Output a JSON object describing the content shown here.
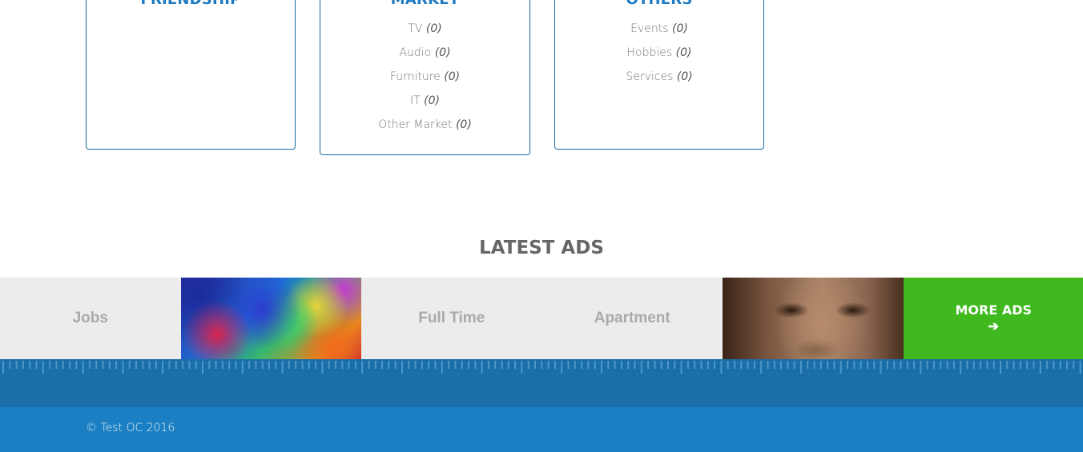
{
  "categories": [
    {
      "title": "FRIENDSHIP",
      "items": []
    },
    {
      "title": "MARKET",
      "items": [
        {
          "label": "TV",
          "count": "(0)"
        },
        {
          "label": "Audio",
          "count": "(0)"
        },
        {
          "label": "Furniture",
          "count": "(0)"
        },
        {
          "label": "IT",
          "count": "(0)"
        },
        {
          "label": "Other Market",
          "count": "(0)"
        }
      ]
    },
    {
      "title": "OTHERS",
      "items": [
        {
          "label": "Events",
          "count": "(0)"
        },
        {
          "label": "Hobbies",
          "count": "(0)"
        },
        {
          "label": "Services",
          "count": "(0)"
        }
      ]
    }
  ],
  "latest_ads": {
    "title": "LATEST ADS",
    "tiles": [
      {
        "label": "Jobs"
      },
      {
        "label": ""
      },
      {
        "label": "Full Time"
      },
      {
        "label": "Apartment"
      },
      {
        "label": ""
      }
    ],
    "more_label": "MORE ADS",
    "more_icon": "arrow-right-icon"
  },
  "footer": {
    "copyright": "© Test OC 2016"
  },
  "colors": {
    "brand_blue": "#1e7bc3",
    "footer_dark": "#1a6fa8",
    "footer_light": "#1b80c3",
    "more_ads_green": "#3fb91e"
  }
}
